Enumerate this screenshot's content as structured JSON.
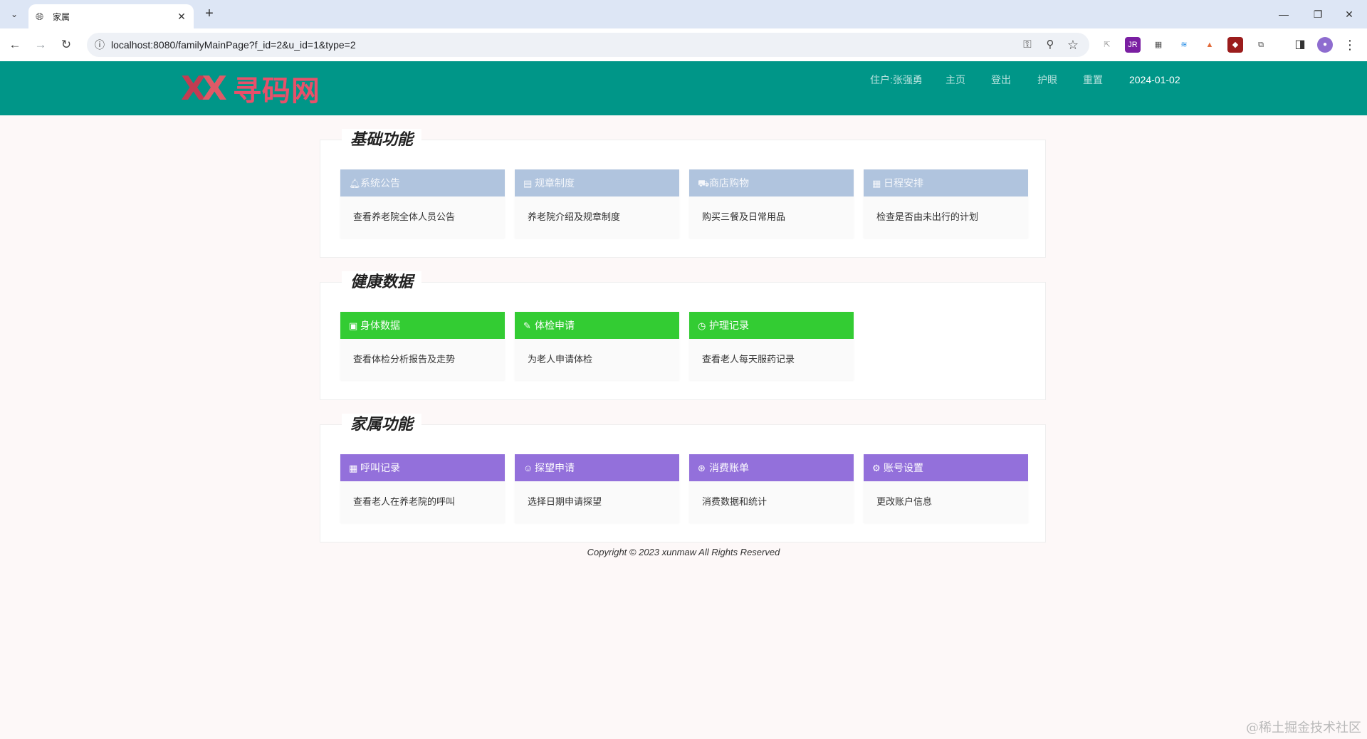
{
  "browser": {
    "tab_title": "家属",
    "tab_close": "✕",
    "new_tab": "+",
    "tab_list": "⌄",
    "url": "localhost:8080/familyMainPage?f_id=2&u_id=1&type=2",
    "back": "←",
    "forward": "→",
    "reload": "↻",
    "info_icon": "ⓘ",
    "key_icon": "⚿",
    "zoom_icon": "⚲",
    "star_icon": "☆",
    "minimize": "—",
    "restore": "❐",
    "close": "✕",
    "extensions": [
      {
        "name": "cursor-ext-icon",
        "glyph": "⇱",
        "color": "#ffffff",
        "text": "#999999"
      },
      {
        "name": "jrebel-ext-icon",
        "glyph": "JR",
        "color": "#7a1fa2",
        "text": "#ffffff"
      },
      {
        "name": "store-ext-icon",
        "glyph": "▦",
        "color": "#ffffff",
        "text": "#555555"
      },
      {
        "name": "layers-ext-icon",
        "glyph": "≋",
        "color": "#ffffff",
        "text": "#1e88e5"
      },
      {
        "name": "pyramid-ext-icon",
        "glyph": "▲",
        "color": "#ffffff",
        "text": "#e26b3a"
      },
      {
        "name": "ublock-ext-icon",
        "glyph": "◆",
        "color": "#9b1c1c",
        "text": "#ffffff"
      },
      {
        "name": "puzzle-ext-icon",
        "glyph": "⧉",
        "color": "#ffffff",
        "text": "#444444"
      }
    ],
    "sidepanel_icon": "◨",
    "profile_icon": "●",
    "menu_icon": "⋮"
  },
  "header": {
    "logo_mark_a": "X",
    "logo_mark_b": "X",
    "logo_text": "寻码网",
    "nav": [
      {
        "label": "住户:张强勇"
      },
      {
        "label": "主页"
      },
      {
        "label": "登出"
      },
      {
        "label": "护眼"
      },
      {
        "label": "重置"
      }
    ],
    "date": "2024-01-02"
  },
  "sections": [
    {
      "title": "基础功能",
      "color": "blue",
      "cards": [
        {
          "icon": "bell-icon",
          "glyph": "🔔︎",
          "label": "系统公告",
          "desc": "查看养老院全体人员公告"
        },
        {
          "icon": "document-icon",
          "glyph": "▤",
          "label": "规章制度",
          "desc": "养老院介绍及规章制度"
        },
        {
          "icon": "cart-icon",
          "glyph": "⛟",
          "label": "商店购物",
          "desc": "购买三餐及日常用品"
        },
        {
          "icon": "calendar-icon",
          "glyph": "▦",
          "label": "日程安排",
          "desc": "检查是否由未出行的计划"
        }
      ]
    },
    {
      "title": "健康数据",
      "color": "green",
      "cards": [
        {
          "icon": "chart-icon",
          "glyph": "▣",
          "label": "身体数据",
          "desc": "查看体检分析报告及走势"
        },
        {
          "icon": "edit-icon",
          "glyph": "✎",
          "label": "体检申请",
          "desc": "为老人申请体检"
        },
        {
          "icon": "clock-icon",
          "glyph": "◷",
          "label": "护理记录",
          "desc": "查看老人每天服药记录"
        }
      ]
    },
    {
      "title": "家属功能",
      "color": "purple",
      "cards": [
        {
          "icon": "list-icon",
          "glyph": "▦",
          "label": "呼叫记录",
          "desc": "查看老人在养老院的呼叫"
        },
        {
          "icon": "user-icon",
          "glyph": "☺",
          "label": "探望申请",
          "desc": "选择日期申请探望"
        },
        {
          "icon": "money-icon",
          "glyph": "⊛",
          "label": "消费账单",
          "desc": "消费数据和统计"
        },
        {
          "icon": "gear-icon",
          "glyph": "⚙",
          "label": "账号设置",
          "desc": "更改账户信息"
        }
      ]
    }
  ],
  "footer": "Copyright © 2023 xunmaw All Rights Reserved",
  "watermark": "@稀土掘金技术社区"
}
